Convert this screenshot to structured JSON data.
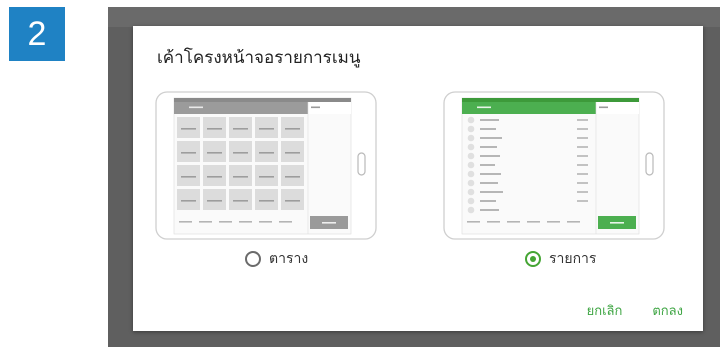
{
  "step": {
    "number": "2",
    "color": "#1f82c4"
  },
  "dialog": {
    "title": "เค้าโครงหน้าจอรายการเมนู",
    "options": [
      {
        "label": "ตาราง",
        "selected": false,
        "preview_icon": "grid-layout-tablet-icon"
      },
      {
        "label": "รายการ",
        "selected": true,
        "preview_icon": "list-layout-tablet-icon"
      }
    ],
    "actions": {
      "cancel": "ยกเลิก",
      "ok": "ตกลง"
    },
    "accent_color": "#45a534"
  }
}
